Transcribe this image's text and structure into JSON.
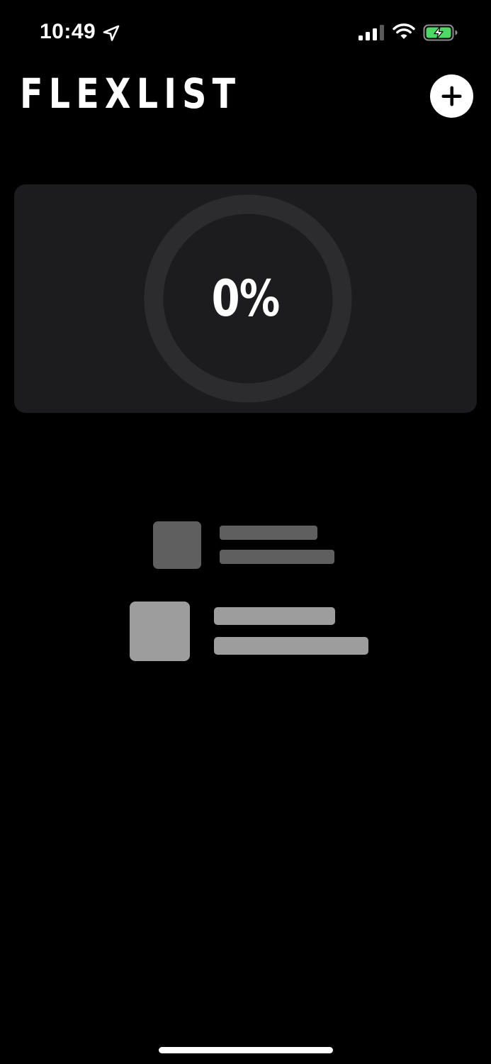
{
  "status_bar": {
    "time": "10:49",
    "icons": [
      "location-arrow-icon",
      "cellular-signal-icon",
      "wifi-icon",
      "battery-charging-icon"
    ],
    "battery_color": "#4cd964"
  },
  "header": {
    "app_title": "FLEXLIST",
    "add_button_icon": "plus-icon"
  },
  "progress_card": {
    "progress_label": "0%",
    "progress_fraction": 0,
    "ring_track_color": "#2c2c2e",
    "card_color": "#1c1c1e"
  },
  "empty_state": {
    "illustration": "placeholder-list-illustration"
  },
  "colors": {
    "background": "#000000",
    "text": "#ffffff"
  }
}
